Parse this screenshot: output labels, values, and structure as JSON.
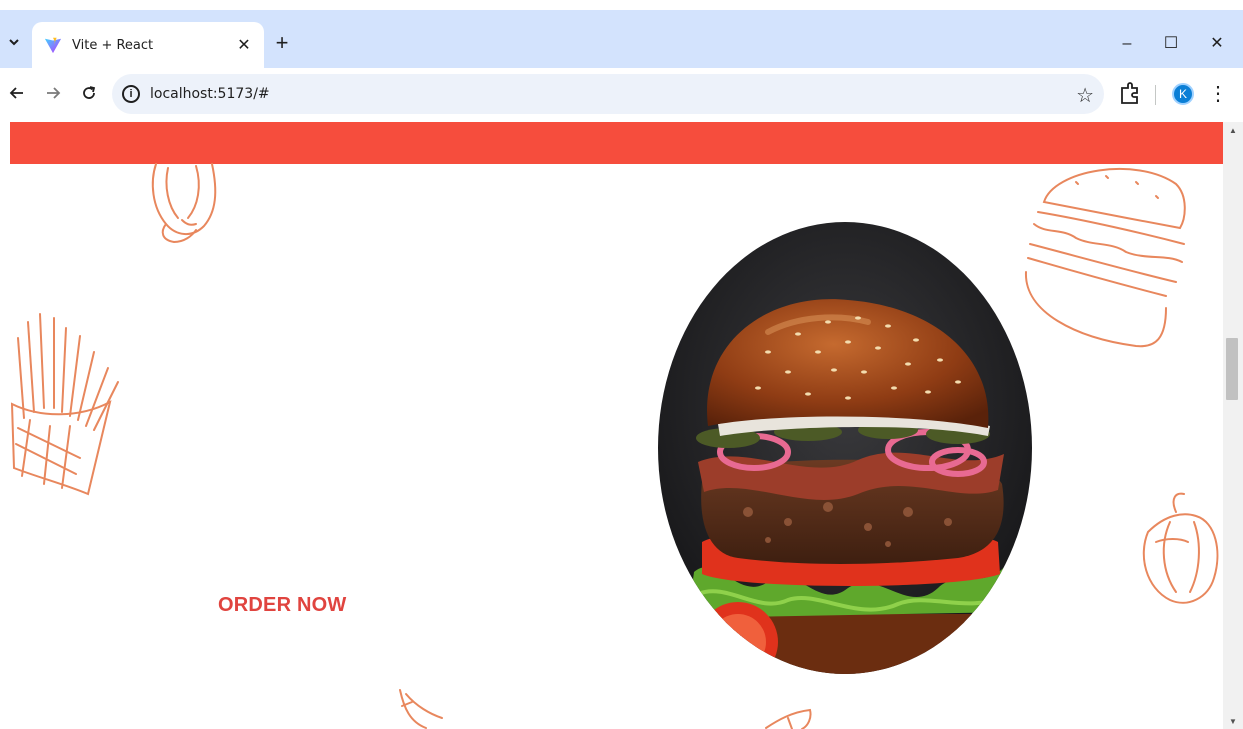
{
  "browser": {
    "tab_title": "Vite + React",
    "tab_close": "✕",
    "new_tab": "+",
    "url": "localhost:5173/#",
    "profile_initial": "K",
    "window_controls": {
      "minimize": "–",
      "maximize": "☐",
      "close": "✕"
    }
  },
  "page": {
    "cta_label": "ORDER NOW",
    "accent_color": "#f64d3d",
    "cta_color": "#e0443f",
    "sketch_color": "#e8875d"
  },
  "icons": {
    "tab_search": "chevron-down-icon",
    "back": "arrow-left-icon",
    "forward": "arrow-right-icon",
    "reload": "reload-icon",
    "site_info": "info-icon",
    "bookmark": "star-icon",
    "extensions": "puzzle-icon",
    "menu": "kebab-menu-icon"
  }
}
